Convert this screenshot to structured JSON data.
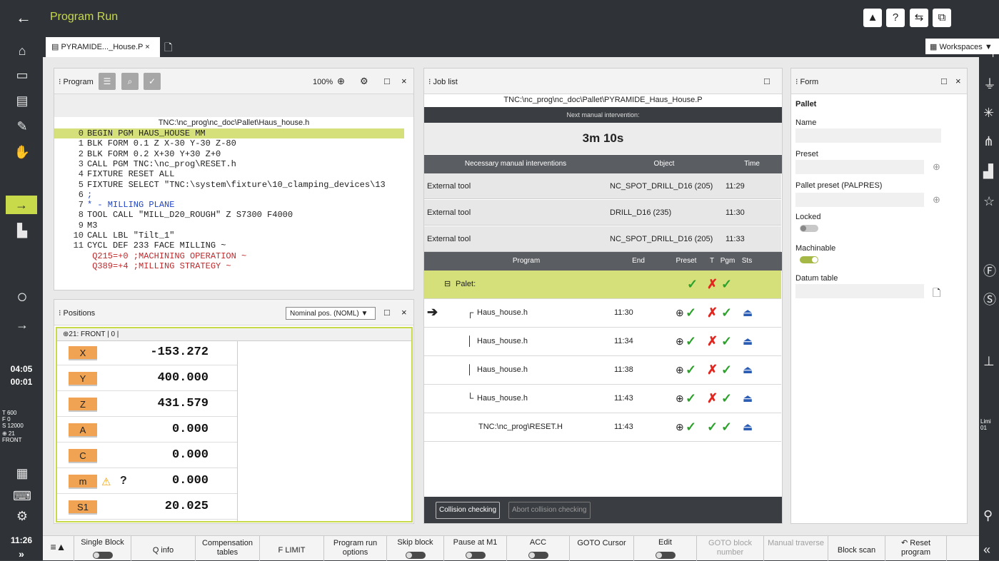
{
  "top": {
    "back_icon": "arrow-left-icon",
    "title": "Program Run",
    "icons": [
      "warning-icon",
      "help-icon",
      "transfer-icon",
      "windows-icon"
    ]
  },
  "tab": {
    "label": "PYRAMIDE..._House.P",
    "close": "×"
  },
  "workspaces": "Workspaces",
  "left": {
    "clock1": "04:05",
    "clock2": "00:01",
    "status": [
      "T   600",
      "F      0",
      "S 12000",
      "⊕   21",
      "FRONT"
    ],
    "time": "11:26",
    "more": "»"
  },
  "right": {
    "limit": "Limi\n01"
  },
  "program": {
    "title": "⁝ Program",
    "zoom": "100%",
    "path": "TNC:\\nc_prog\\nc_doc\\Pallet\\Haus_house.h",
    "lines": [
      {
        "n": "0",
        "t": "BEGIN PGM HAUS_HOUSE MM"
      },
      {
        "n": "1",
        "t": "BLK FORM 0.1 Z X-30 Y-30 Z-80"
      },
      {
        "n": "2",
        "t": "BLK FORM 0.2 X+30 Y+30 Z+0"
      },
      {
        "n": "3",
        "t": "CALL PGM TNC:\\nc_prog\\RESET.h"
      },
      {
        "n": "4",
        "t": "FIXTURE RESET ALL"
      },
      {
        "n": "5",
        "t": "FIXTURE SELECT \"TNC:\\system\\fixture\\10_clamping_devices\\13"
      },
      {
        "n": "6",
        "t": ";"
      },
      {
        "n": "7",
        "t": "* - MILLING PLANE"
      },
      {
        "n": "8",
        "t": "TOOL CALL \"MILL_D20_ROUGH\" Z S7300 F4000"
      },
      {
        "n": "9",
        "t": "M3"
      },
      {
        "n": "10",
        "t": "CALL LBL \"Tilt_1\""
      },
      {
        "n": "11",
        "t": "CYCL DEF 233 FACE MILLING ~"
      },
      {
        "n": "",
        "t": "  Q215=+0 ;MACHINING OPERATION ~"
      },
      {
        "n": "",
        "t": "  Q389=+4 ;MILLING STRATEGY ~"
      }
    ]
  },
  "positions": {
    "title": "⁝ Positions",
    "mode": "Nominal pos. (NOML) ▼",
    "info": "⊕21: FRONT | 0 |",
    "rows": [
      {
        "axis": "X",
        "val": "-153.272"
      },
      {
        "axis": "Y",
        "val": "400.000"
      },
      {
        "axis": "Z",
        "val": "431.579"
      },
      {
        "axis": "A",
        "val": "0.000"
      },
      {
        "axis": "C",
        "val": "0.000"
      },
      {
        "axis": "m",
        "val": "0.000",
        "extra": "?"
      },
      {
        "axis": "S1",
        "val": "20.025"
      }
    ]
  },
  "job": {
    "title": "⁝ Job list",
    "path": "TNC:\\nc_prog\\nc_doc\\Pallet\\PYRAMIDE_Haus_House.P",
    "next_label": "Next manual intervention:",
    "next_time": "3m 10s",
    "int_headers": [
      "Necessary manual interventions",
      "Object",
      "Time"
    ],
    "interventions": [
      {
        "a": "External tool",
        "b": "NC_SPOT_DRILL_D16 (205)",
        "c": "11:29"
      },
      {
        "a": "External tool",
        "b": "DRILL_D16 (235)",
        "c": "11:30"
      },
      {
        "a": "External tool",
        "b": "NC_SPOT_DRILL_D16 (205)",
        "c": "11:33"
      }
    ],
    "prog_headers": [
      "Program",
      "End",
      "Preset",
      "T",
      "Pgm",
      "Sts"
    ],
    "pallet": "Palet:",
    "programs": [
      {
        "name": "Haus_house.h",
        "end": "11:30"
      },
      {
        "name": "Haus_house.h",
        "end": "11:34"
      },
      {
        "name": "Haus_house.h",
        "end": "11:38"
      },
      {
        "name": "Haus_house.h",
        "end": "11:43"
      },
      {
        "name": "TNC:\\nc_prog\\RESET.H",
        "end": "11:43"
      }
    ],
    "btn_collision": "Collision checking",
    "btn_abort": "Abort collision checking"
  },
  "form": {
    "title": "⁝ Form",
    "section": "Pallet",
    "fields": [
      "Name",
      "Preset",
      "Pallet preset (PALPRES)",
      "Locked",
      "Machinable",
      "Datum table"
    ]
  },
  "bottom": {
    "items": [
      "Single Block",
      "Q info",
      "Compensation tables",
      "F LIMIT",
      "Program run options",
      "Skip block",
      "Pause at M1",
      "ACC",
      "GOTO Cursor",
      "Edit",
      "GOTO block number",
      "Manual traverse",
      "Block scan",
      "Reset program"
    ]
  }
}
